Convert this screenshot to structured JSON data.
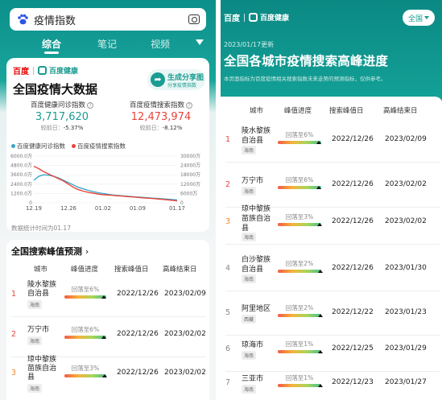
{
  "search": {
    "query": "疫情指数"
  },
  "tabs": [
    {
      "label": "综合"
    },
    {
      "label": "笔记"
    },
    {
      "label": "视频"
    }
  ],
  "card": {
    "brand_baidu": "百度",
    "brand_health": "百度健康",
    "title": "全国疫情大数据",
    "share_title": "生成分享图",
    "share_sub": "分享疫情指数",
    "metrics": [
      {
        "label": "百度健康问诊指数",
        "value": "3,717,620",
        "change_label": "较前日：",
        "change": "-5.37%",
        "color": "#1a9c92"
      },
      {
        "label": "百度疫情搜索指数",
        "value": "12,473,974",
        "change_label": "较前日：",
        "change": "-8.12%",
        "color": "#e8443a"
      }
    ],
    "legend": [
      "百度健康问诊指数",
      "百度疫情搜索指数"
    ],
    "deadline": "数据统计时间为01.17"
  },
  "chart_data": {
    "type": "line",
    "x": [
      "12.19",
      "12.20",
      "12.21",
      "12.22",
      "12.23",
      "12.24",
      "12.25",
      "12.26",
      "12.27",
      "12.28",
      "12.29",
      "12.30",
      "12.31",
      "01.01",
      "01.02",
      "01.03",
      "01.04",
      "01.05",
      "01.06",
      "01.07",
      "01.08",
      "01.09",
      "01.10",
      "01.11",
      "01.12",
      "01.13",
      "01.14",
      "01.15",
      "01.16",
      "01.17"
    ],
    "x_ticks": [
      "12.19",
      "12.26",
      "01.02",
      "01.09",
      "01.17"
    ],
    "y_left": {
      "ticks": [
        "6000.0万",
        "4800.0万",
        "3600.0万",
        "2400.0万",
        "1200.0万",
        "0"
      ],
      "range": [
        0,
        6000
      ]
    },
    "y_right": {
      "ticks": [
        "30000万",
        "24000万",
        "18000万",
        "12000万",
        "6000万",
        "0"
      ],
      "range": [
        0,
        30000
      ]
    },
    "series": [
      {
        "name": "百度健康问诊指数",
        "color": "#3aa6c8",
        "axis": "left",
        "values": [
          2900,
          3400,
          3600,
          3550,
          3400,
          3200,
          2900,
          2600,
          2300,
          2000,
          1800,
          1600,
          1450,
          1300,
          1200,
          1100,
          1000,
          950,
          900,
          850,
          800,
          750,
          700,
          650,
          600,
          560,
          520,
          480,
          420,
          372
        ]
      },
      {
        "name": "百度疫情搜索指数",
        "color": "#e8443a",
        "axis": "right",
        "values": [
          23500,
          22000,
          20000,
          18500,
          17000,
          15500,
          14000,
          12000,
          10000,
          8500,
          7500,
          6800,
          6200,
          5600,
          5200,
          5000,
          4800,
          4500,
          4300,
          4000,
          3800,
          3500,
          3200,
          3000,
          2800,
          2500,
          2200,
          1900,
          1600,
          1247
        ]
      }
    ]
  },
  "peak_card": {
    "title": "全国搜索峰值预测",
    "arrow": "›",
    "headers": [
      "城市",
      "峰值进度",
      "搜索峰值日",
      "高峰结束日"
    ],
    "rows": [
      {
        "rank": "1",
        "city": "陵水黎族自治县",
        "tag": "海南",
        "progress_text": "回落至6%",
        "progress": 0.94,
        "peak": "2022/12/26",
        "end": "2023/02/09"
      },
      {
        "rank": "2",
        "city": "万宁市",
        "tag": "海南",
        "progress_text": "回落至6%",
        "progress": 0.94,
        "peak": "2022/12/26",
        "end": "2023/02/02"
      },
      {
        "rank": "3",
        "city": "琼中黎族苗族自治县",
        "tag": "海南",
        "progress_text": "回落至3%",
        "progress": 0.97,
        "peak": "2022/12/26",
        "end": "2023/02/02"
      }
    ]
  },
  "right": {
    "brand_baidu": "百度",
    "brand_health": "百度健康",
    "region_button": "全国",
    "updated": "2023/01/17更新",
    "title": "全国各城市疫情搜索高峰进度",
    "desc": "本页面指标为百度疫情相关搜索指数未来走势的预测指标，仅供参考。",
    "headers": [
      "城市",
      "峰值进度",
      "搜索峰值日",
      "高峰结束日"
    ],
    "rows": [
      {
        "rank": "1",
        "city": "陵水黎族自治县",
        "tag": "海南",
        "progress_text": "回落至6%",
        "progress": 0.94,
        "peak": "2022/12/26",
        "end": "2023/02/09"
      },
      {
        "rank": "2",
        "city": "万宁市",
        "tag": "海南",
        "progress_text": "回落至6%",
        "progress": 0.94,
        "peak": "2022/12/26",
        "end": "2023/02/02"
      },
      {
        "rank": "3",
        "city": "琼中黎族苗族自治县",
        "tag": "海南",
        "progress_text": "回落至3%",
        "progress": 0.97,
        "peak": "2022/12/26",
        "end": "2023/02/02"
      },
      {
        "rank": "4",
        "city": "白沙黎族自治县",
        "tag": "海南",
        "progress_text": "回落至2%",
        "progress": 0.98,
        "peak": "2022/12/26",
        "end": "2023/01/30"
      },
      {
        "rank": "5",
        "city": "阿里地区",
        "tag": "西藏",
        "progress_text": "回落至2%",
        "progress": 0.98,
        "peak": "2022/12/22",
        "end": "2023/01/23"
      },
      {
        "rank": "6",
        "city": "琼海市",
        "tag": "海南",
        "progress_text": "回落至1%",
        "progress": 0.99,
        "peak": "2022/12/25",
        "end": "2023/01/29"
      },
      {
        "rank": "7",
        "city": "三亚市",
        "tag": "海南",
        "progress_text": "回落至1%",
        "progress": 0.99,
        "peak": "2022/12/23",
        "end": "2023/01/27"
      }
    ]
  },
  "colors": {
    "teal": "#1a9c92",
    "rank_red": "#e8443a",
    "rank_orange": "#f08a24",
    "rank_gray": "#888888"
  }
}
